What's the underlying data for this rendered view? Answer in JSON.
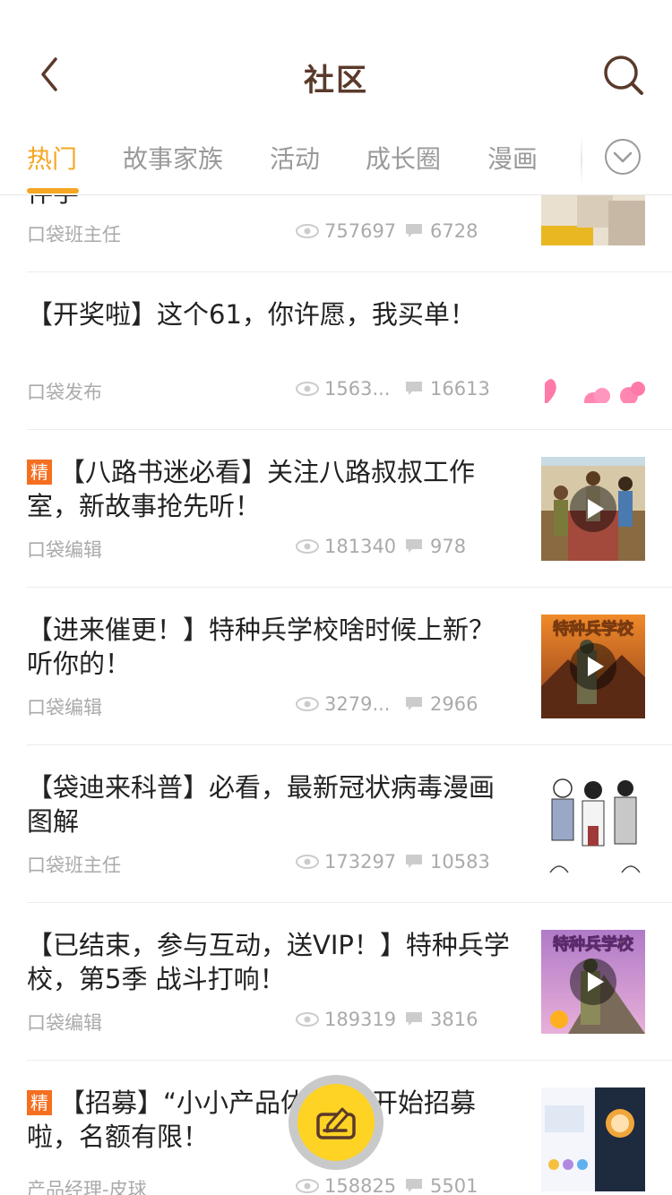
{
  "header": {
    "title": "社区",
    "back_icon": "chevron-left-icon",
    "search_icon": "search-icon"
  },
  "tabs": [
    {
      "label": "热门",
      "active": true
    },
    {
      "label": "故事家族",
      "active": false
    },
    {
      "label": "活动",
      "active": false
    },
    {
      "label": "成长圈",
      "active": false
    },
    {
      "label": "漫画",
      "active": false
    }
  ],
  "accent_color": "#f5a623",
  "feed": [
    {
      "title": "伴学",
      "author": "口袋班主任",
      "views": "757697",
      "comments": "6728",
      "featured": false
    },
    {
      "title": "【开奖啦】这个61，你许愿，我买单！",
      "author": "口袋发布",
      "views": "1563...",
      "comments": "16613",
      "featured": false
    },
    {
      "title": "【八路书迷必看】关注八路叔叔工作室，新故事抢先听！",
      "author": "口袋编辑",
      "views": "181340",
      "comments": "978",
      "featured": true,
      "badge": "精"
    },
    {
      "title": "【进来催更！】特种兵学校啥时候上新？听你的！",
      "author": "口袋编辑",
      "views": "3279...",
      "comments": "2966",
      "featured": false
    },
    {
      "title": "【袋迪来科普】必看，最新冠状病毒漫画图解",
      "author": "口袋班主任",
      "views": "173297",
      "comments": "10583",
      "featured": false
    },
    {
      "title": "【已结束，参与互动，送VIP！】特种兵学校，第5季 战斗打响！",
      "author": "口袋编辑",
      "views": "189319",
      "comments": "3816",
      "featured": false
    },
    {
      "title": "【招募】“小小产品体验官”开始招募啦，名额有限！",
      "author": "产品经理-皮球",
      "views": "158825",
      "comments": "5501",
      "featured": true,
      "badge": "精"
    }
  ],
  "thumb_text": {
    "sbs1": "特种兵学校",
    "sbs2": "特种兵学校"
  }
}
